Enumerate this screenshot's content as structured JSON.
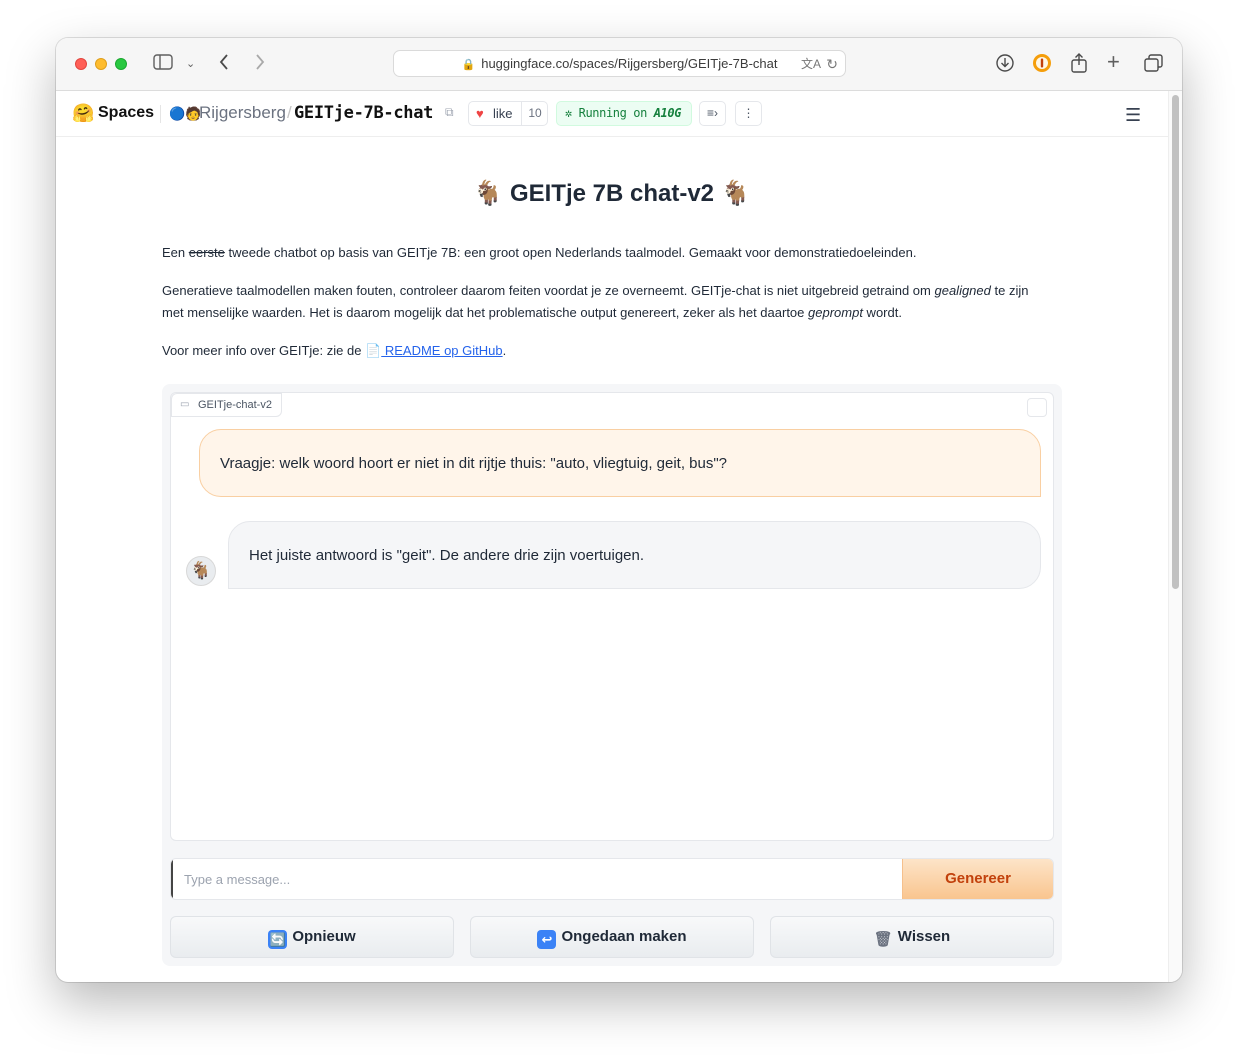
{
  "browser": {
    "url": "huggingface.co/spaces/Rijgersberg/GEITje-7B-chat",
    "icons": [
      "sidebar-icon",
      "chevron-down-icon",
      "back-icon",
      "forward-icon",
      "lock-icon",
      "translate-icon",
      "reload-icon",
      "download-icon",
      "password-icon",
      "share-icon",
      "new-tab-icon",
      "tabs-overview-icon"
    ]
  },
  "header": {
    "brand": "Spaces",
    "owner": "Rijgersberg",
    "separator": "/",
    "repo": "GEITje-7B-chat",
    "like_label": "like",
    "like_count": "10",
    "status_prefix": "Running on",
    "status_hardware": "A10G"
  },
  "page": {
    "title": "🐐 GEITje 7B chat-v2 🐐",
    "intro": {
      "prefix": "Een ",
      "struck": "eerste",
      "rest": " tweede chatbot op basis van GEITje 7B: een groot open Nederlands taalmodel. Gemaakt voor demonstratiedoeleinden."
    },
    "warning": {
      "part1": "Generatieve taalmodellen maken fouten, controleer daarom feiten voordat je ze overneemt. GEITje-chat is niet uitgebreid getraind om ",
      "em1": "gealigned",
      "part2": " te zijn met menselijke waarden. Het is daarom mogelijk dat het problematische output genereert, zeker als het daartoe ",
      "em2": "geprompt",
      "part3": " wordt."
    },
    "info": {
      "prefix": "Voor meer info over GEITje: zie de ",
      "link": " README op GitHub",
      "suffix": "."
    }
  },
  "chat": {
    "label": "GEITje-chat-v2",
    "messages": [
      {
        "role": "user",
        "text": "Vraagje: welk woord hoort er niet in dit rijtje thuis: \"auto, vliegtuig, geit, bus\"?"
      },
      {
        "role": "bot",
        "text": "Het juiste antwoord is \"geit\". De andere drie zijn voertuigen."
      }
    ],
    "input_placeholder": "Type a message...",
    "input_value": "",
    "send_label": "Genereer"
  },
  "buttons": {
    "retry": "Opnieuw",
    "undo": "Ongedaan maken",
    "clear": "Wissen"
  },
  "colors": {
    "accent_orange": "#f9c58f",
    "user_bubble": "#fff5ea",
    "running_green": "#15803d",
    "link_blue": "#2563eb"
  }
}
